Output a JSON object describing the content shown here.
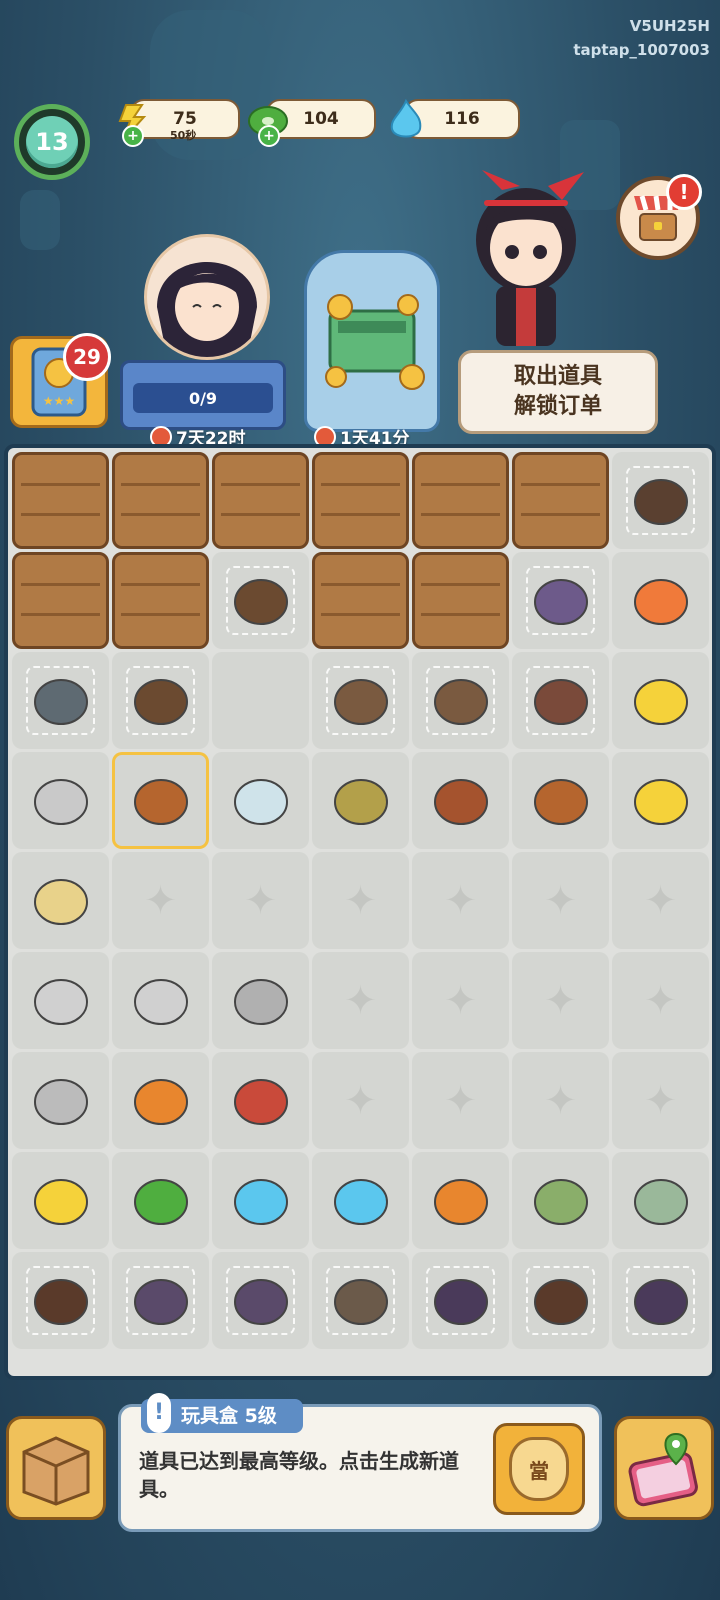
{
  "header": {
    "user_id_line1": "V5UH25H",
    "user_id_line2": "taptap_1007003",
    "level": "13"
  },
  "resources": [
    {
      "name": "lightning-energy",
      "value": "75",
      "sub": "50秒",
      "has_plus": true,
      "color": "#f5d23a"
    },
    {
      "name": "jade-coin",
      "value": "104",
      "has_plus": true,
      "color": "#4fae3f"
    },
    {
      "name": "blue-flame",
      "value": "116",
      "has_plus": false,
      "color": "#5bc7ee"
    }
  ],
  "left_card": {
    "badge": "29"
  },
  "order": {
    "progress": "0/9",
    "progress_fraction": 0.0,
    "timer": "7天22时"
  },
  "chest": {
    "timer": "1天41分"
  },
  "unlock_box": {
    "line1": "取出道具",
    "line2": "解锁订单"
  },
  "board": {
    "columns": 7,
    "rows": [
      [
        {
          "t": "plank"
        },
        {
          "t": "plank"
        },
        {
          "t": "plank"
        },
        {
          "t": "plank"
        },
        {
          "t": "plank"
        },
        {
          "t": "plank"
        },
        {
          "t": "item",
          "icon": "dark-jar-icon",
          "web": true
        }
      ],
      [
        {
          "t": "plank"
        },
        {
          "t": "plank"
        },
        {
          "t": "item",
          "icon": "basket-icon",
          "web": true
        },
        {
          "t": "plank"
        },
        {
          "t": "plank"
        },
        {
          "t": "item",
          "icon": "purple-bottle-icon",
          "web": true
        },
        {
          "t": "item",
          "icon": "gem-pile-icon"
        }
      ],
      [
        {
          "t": "item",
          "icon": "teapot-icon",
          "web": true
        },
        {
          "t": "item",
          "icon": "sticks-icon",
          "web": true
        },
        {
          "t": "empty-plain"
        },
        {
          "t": "item",
          "icon": "egg-tray-icon",
          "web": true
        },
        {
          "t": "item",
          "icon": "egg-tray-icon",
          "web": true
        },
        {
          "t": "item",
          "icon": "leather-bag-icon",
          "web": true
        },
        {
          "t": "item",
          "icon": "double-lightning-icon"
        }
      ],
      [
        {
          "t": "item",
          "icon": "scissors-icon"
        },
        {
          "t": "item",
          "icon": "toy-chest-icon",
          "selected": true
        },
        {
          "t": "item",
          "icon": "tea-set-icon"
        },
        {
          "t": "item",
          "icon": "cabinet-icon"
        },
        {
          "t": "item",
          "icon": "drawer-icon"
        },
        {
          "t": "item",
          "icon": "brush-icon"
        },
        {
          "t": "item",
          "icon": "triple-lightning-icon"
        }
      ],
      [
        {
          "t": "item",
          "icon": "whisk-icon"
        },
        {
          "t": "empty"
        },
        {
          "t": "empty"
        },
        {
          "t": "empty"
        },
        {
          "t": "empty"
        },
        {
          "t": "empty"
        },
        {
          "t": "empty"
        }
      ],
      [
        {
          "t": "item",
          "icon": "saw-icon"
        },
        {
          "t": "item",
          "icon": "knife-icon"
        },
        {
          "t": "item",
          "icon": "spoon-icon"
        },
        {
          "t": "empty"
        },
        {
          "t": "empty"
        },
        {
          "t": "empty"
        },
        {
          "t": "empty"
        }
      ],
      [
        {
          "t": "item",
          "icon": "tape-icon"
        },
        {
          "t": "item",
          "icon": "slingshot-icon"
        },
        {
          "t": "item",
          "icon": "awl-icon"
        },
        {
          "t": "empty"
        },
        {
          "t": "empty"
        },
        {
          "t": "empty"
        },
        {
          "t": "empty"
        }
      ],
      [
        {
          "t": "item",
          "icon": "lightning-icon"
        },
        {
          "t": "item",
          "icon": "jade-coin-icon"
        },
        {
          "t": "item",
          "icon": "blue-flames-icon"
        },
        {
          "t": "item",
          "icon": "blue-flame-icon"
        },
        {
          "t": "item",
          "icon": "flashlight-icon"
        },
        {
          "t": "item",
          "icon": "tea-package-icon"
        },
        {
          "t": "item",
          "icon": "cash-bundle-icon"
        }
      ],
      [
        {
          "t": "item",
          "icon": "pot-icon",
          "web": true
        },
        {
          "t": "item",
          "icon": "purple-sack-icon",
          "web": true
        },
        {
          "t": "item",
          "icon": "purple-vase-icon",
          "web": true
        },
        {
          "t": "item",
          "icon": "clay-jar-icon",
          "web": true
        },
        {
          "t": "item",
          "icon": "incense-icon",
          "web": true
        },
        {
          "t": "item",
          "icon": "bowl-icon",
          "web": true
        },
        {
          "t": "item",
          "icon": "small-jar-icon",
          "web": true
        }
      ]
    ]
  },
  "info_panel": {
    "title": "玩具盒 5级",
    "text": "道具已达到最高等级。点击生成新道具。",
    "sell_label": "當"
  }
}
